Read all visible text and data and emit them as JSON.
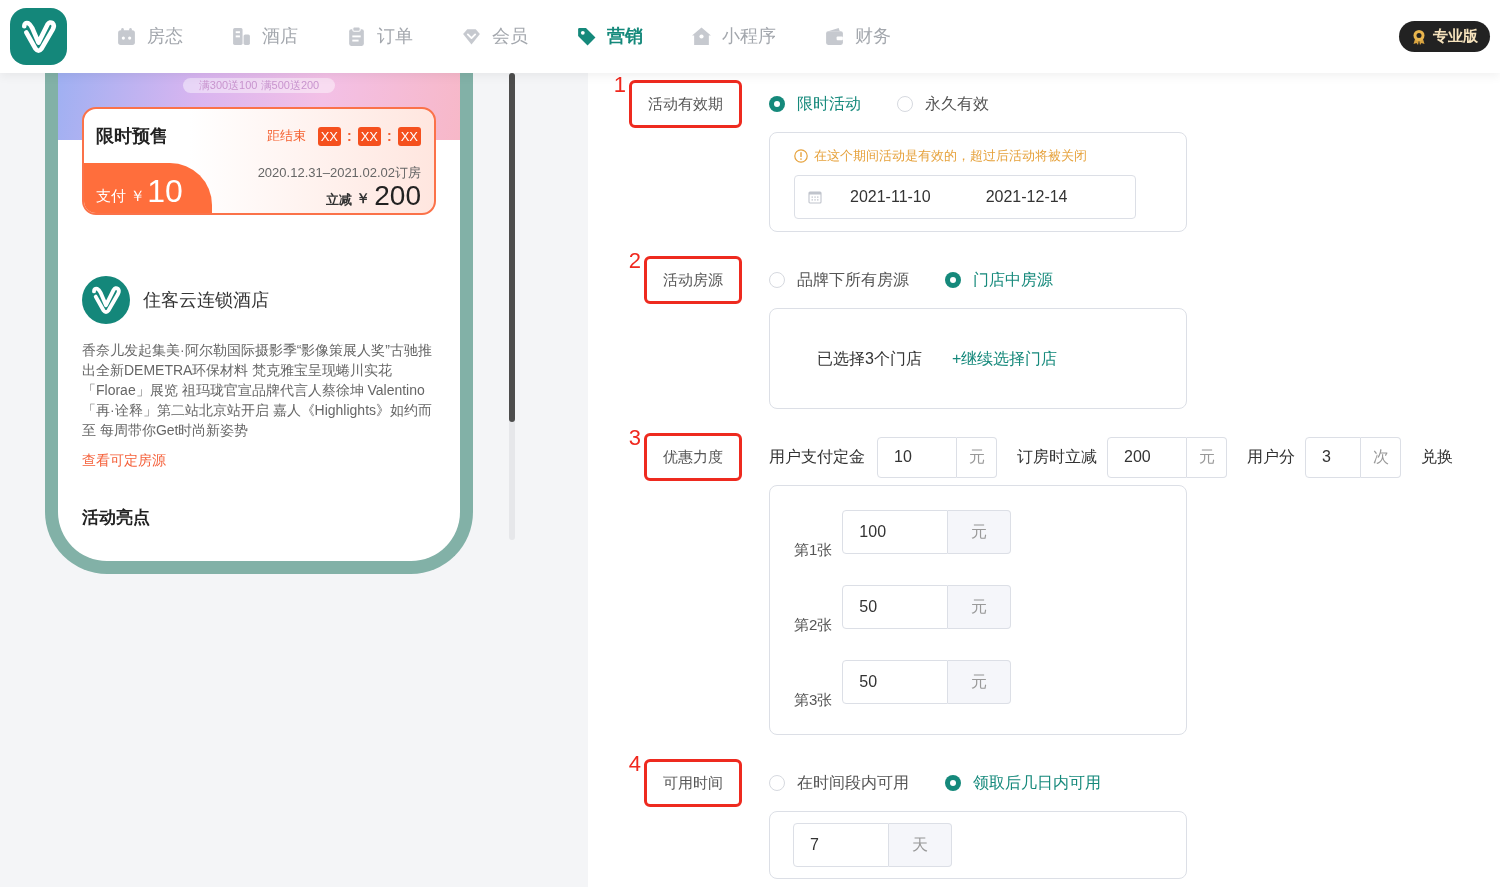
{
  "nav": {
    "items": [
      {
        "label": "房态",
        "selected": false
      },
      {
        "label": "酒店",
        "selected": false
      },
      {
        "label": "订单",
        "selected": false
      },
      {
        "label": "会员",
        "selected": false
      },
      {
        "label": "营销",
        "selected": true
      },
      {
        "label": "小程序",
        "selected": false
      },
      {
        "label": "财务",
        "selected": false
      }
    ],
    "edition_badge": "专业版"
  },
  "preview": {
    "banner_text": "满300送100 满500送200",
    "presale_card": {
      "title": "限时预售",
      "countdown_label": "距结束",
      "countdown": [
        {
          "kind": "box",
          "text": "XX"
        },
        {
          "kind": "separator",
          "text": ":"
        },
        {
          "kind": "box",
          "text": "XX"
        },
        {
          "kind": "separator",
          "text": ":"
        },
        {
          "kind": "box",
          "text": "XX"
        }
      ],
      "pay_label": "支付 ￥",
      "pay_amount": "10",
      "date_range": "2020.12.31–2021.02.02订房",
      "discount_label": "立减",
      "discount_currency": "￥",
      "discount_amount": "200"
    },
    "hotel": {
      "name": "住客云连锁酒店",
      "description": "香奈儿发起集美·阿尔勒国际摄影季“影像策展人奖”古驰推出全新DEMETRA环保材料 梵克雅宝呈现蜷川实花「Florae」展览 祖玛珑官宣品牌代言人蔡徐坤 Valentino「再·诠释」第二站北京站开启 嘉人《Highlights》如约而至 每周带你Get时尚新姿势",
      "link": "查看可定房源"
    },
    "section_title": "活动亮点"
  },
  "form": {
    "sections": [
      {
        "number": "1",
        "label": "活动有效期",
        "options": [
          {
            "label": "限时活动",
            "selected": true
          },
          {
            "label": "永久有效",
            "selected": false
          }
        ],
        "panel": {
          "kind": "date_range",
          "notice": "在这个期间活动是有效的，超过后活动将被关闭",
          "start": "2021-11-10",
          "end": "2021-12-14"
        }
      },
      {
        "number": "2",
        "label": "活动房源",
        "options": [
          {
            "label": "品牌下所有房源",
            "selected": false
          },
          {
            "label": "门店中房源",
            "selected": true
          }
        ],
        "panel": {
          "kind": "stores",
          "summary": "已选择3个门店",
          "link": "+继续选择门店"
        }
      },
      {
        "number": "3",
        "label": "优惠力度",
        "fields": [
          {
            "label": "用户支付定金",
            "value": "10",
            "unit": "元"
          },
          {
            "label": "订房时立减",
            "value": "200",
            "unit": "元"
          },
          {
            "label": "用户分",
            "value": "3",
            "unit": "次"
          }
        ],
        "trailing_text": "兑换",
        "panel": {
          "kind": "coupons",
          "rows": [
            {
              "label": "第1张",
              "value": "100",
              "unit": "元"
            },
            {
              "label": "第2张",
              "value": "50",
              "unit": "元"
            },
            {
              "label": "第3张",
              "value": "50",
              "unit": "元"
            }
          ]
        }
      },
      {
        "number": "4",
        "label": "可用时间",
        "options": [
          {
            "label": "在时间段内可用",
            "selected": false
          },
          {
            "label": "领取后几日内可用",
            "selected": true
          }
        ],
        "panel": {
          "kind": "days",
          "value": "7",
          "unit": "天"
        }
      }
    ]
  }
}
